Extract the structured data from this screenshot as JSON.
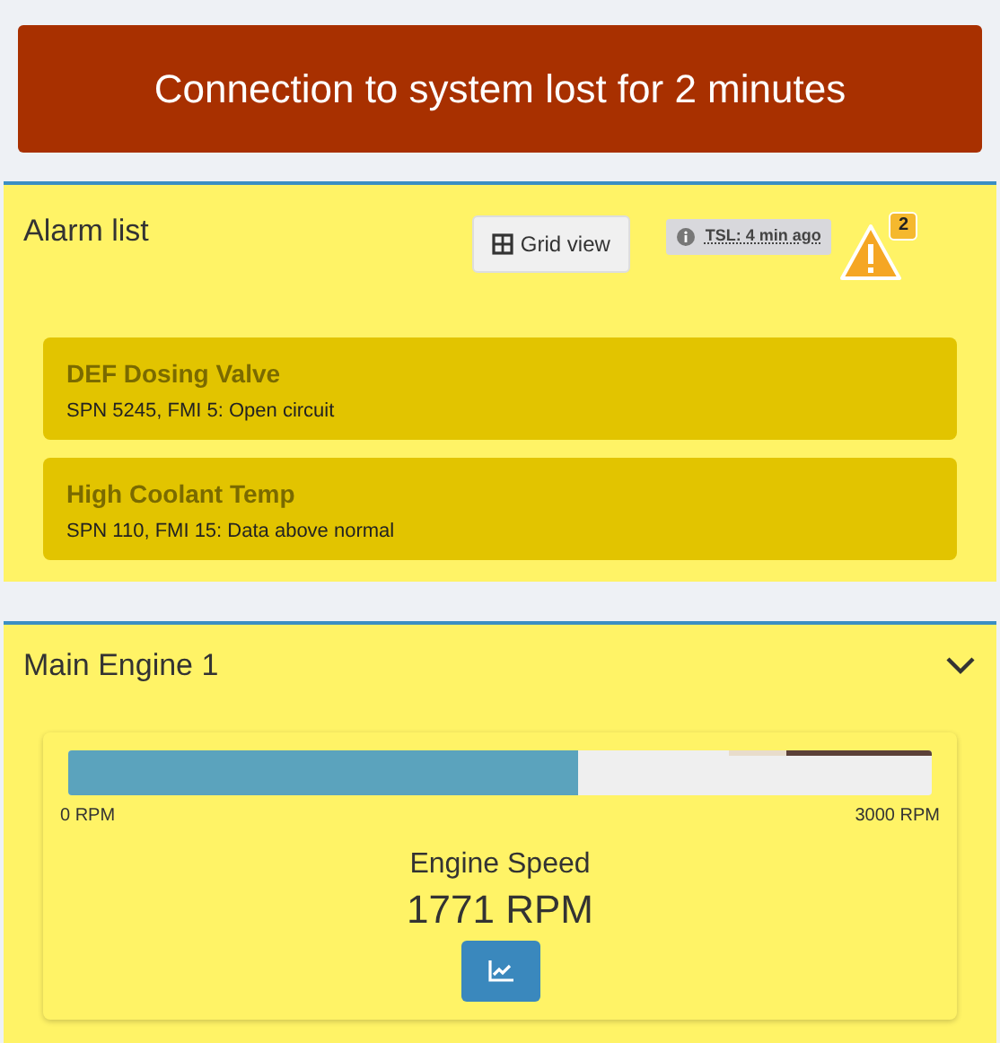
{
  "banner": {
    "text": "Connection to system lost for 2 minutes"
  },
  "alarm_panel": {
    "title": "Alarm list",
    "grid_view_button": "Grid view",
    "tsl_badge": "TSL: 4 min ago",
    "alarm_count": "2",
    "alarms": [
      {
        "title": "DEF Dosing Valve",
        "detail": "SPN 5245, FMI 5: Open circuit"
      },
      {
        "title": "High Coolant Temp",
        "detail": "SPN 110, FMI 15: Data above normal"
      }
    ]
  },
  "engine_panel": {
    "title": "Main Engine 1",
    "expanded": true,
    "gauge": {
      "level": 0.59,
      "min_label": "0 RPM",
      "max_label": "3000 RPM",
      "name": "Engine Speed",
      "reading": "1771 RPM"
    }
  }
}
